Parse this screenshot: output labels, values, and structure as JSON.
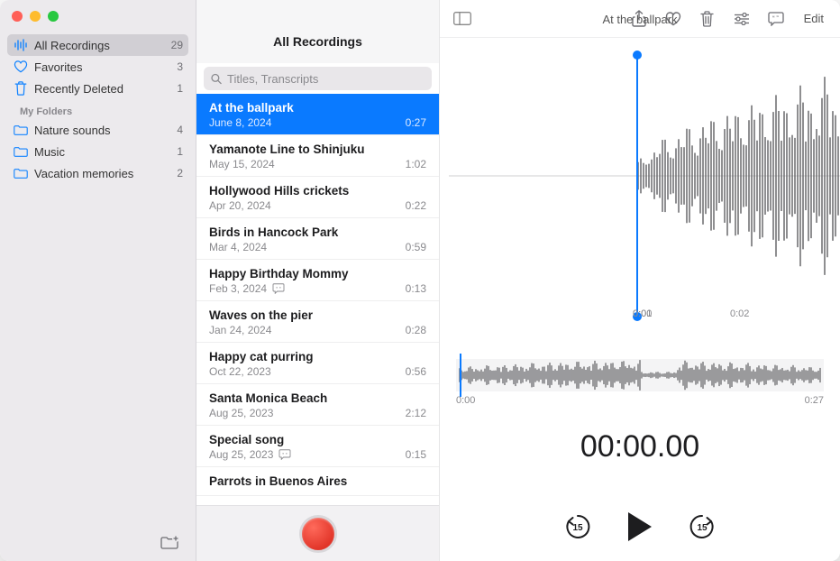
{
  "window": {
    "title": "At the ballpark"
  },
  "toolbar": {
    "edit_label": "Edit"
  },
  "sidebar": {
    "items": [
      {
        "label": "All Recordings",
        "count": "29",
        "icon": "waveform-icon",
        "selected": true
      },
      {
        "label": "Favorites",
        "count": "3",
        "icon": "heart-icon"
      },
      {
        "label": "Recently Deleted",
        "count": "1",
        "icon": "trash-icon"
      }
    ],
    "folders_header": "My Folders",
    "folders": [
      {
        "label": "Nature sounds",
        "count": "4"
      },
      {
        "label": "Music",
        "count": "1"
      },
      {
        "label": "Vacation memories",
        "count": "2"
      }
    ]
  },
  "middle": {
    "header": "All Recordings",
    "search_placeholder": "Titles, Transcripts",
    "recordings": [
      {
        "title": "At the ballpark",
        "date": "June 8, 2024",
        "duration": "0:27",
        "selected": true
      },
      {
        "title": "Yamanote Line to Shinjuku",
        "date": "May 15, 2024",
        "duration": "1:02"
      },
      {
        "title": "Hollywood Hills crickets",
        "date": "Apr 20, 2024",
        "duration": "0:22"
      },
      {
        "title": "Birds in Hancock Park",
        "date": "Mar 4, 2024",
        "duration": "0:59"
      },
      {
        "title": "Happy Birthday Mommy",
        "date": "Feb 3, 2024",
        "duration": "0:13",
        "transcript": true
      },
      {
        "title": "Waves on the pier",
        "date": "Jan 24, 2024",
        "duration": "0:28"
      },
      {
        "title": "Happy cat purring",
        "date": "Oct 22, 2023",
        "duration": "0:56"
      },
      {
        "title": "Santa Monica Beach",
        "date": "Aug 25, 2023",
        "duration": "2:12"
      },
      {
        "title": "Special song",
        "date": "Aug 25, 2023",
        "duration": "0:15",
        "transcript": true
      },
      {
        "title": "Parrots in Buenos Aires",
        "date": "",
        "duration": ""
      }
    ]
  },
  "detail": {
    "timeline_ticks": [
      "0:00",
      "0:01",
      "0:02"
    ],
    "mini_start": "0:00",
    "mini_end": "0:27",
    "big_time": "00:00.00",
    "skip_seconds": "15"
  },
  "colors": {
    "accent": "#0a7aff",
    "record_red": "#e3261c"
  }
}
